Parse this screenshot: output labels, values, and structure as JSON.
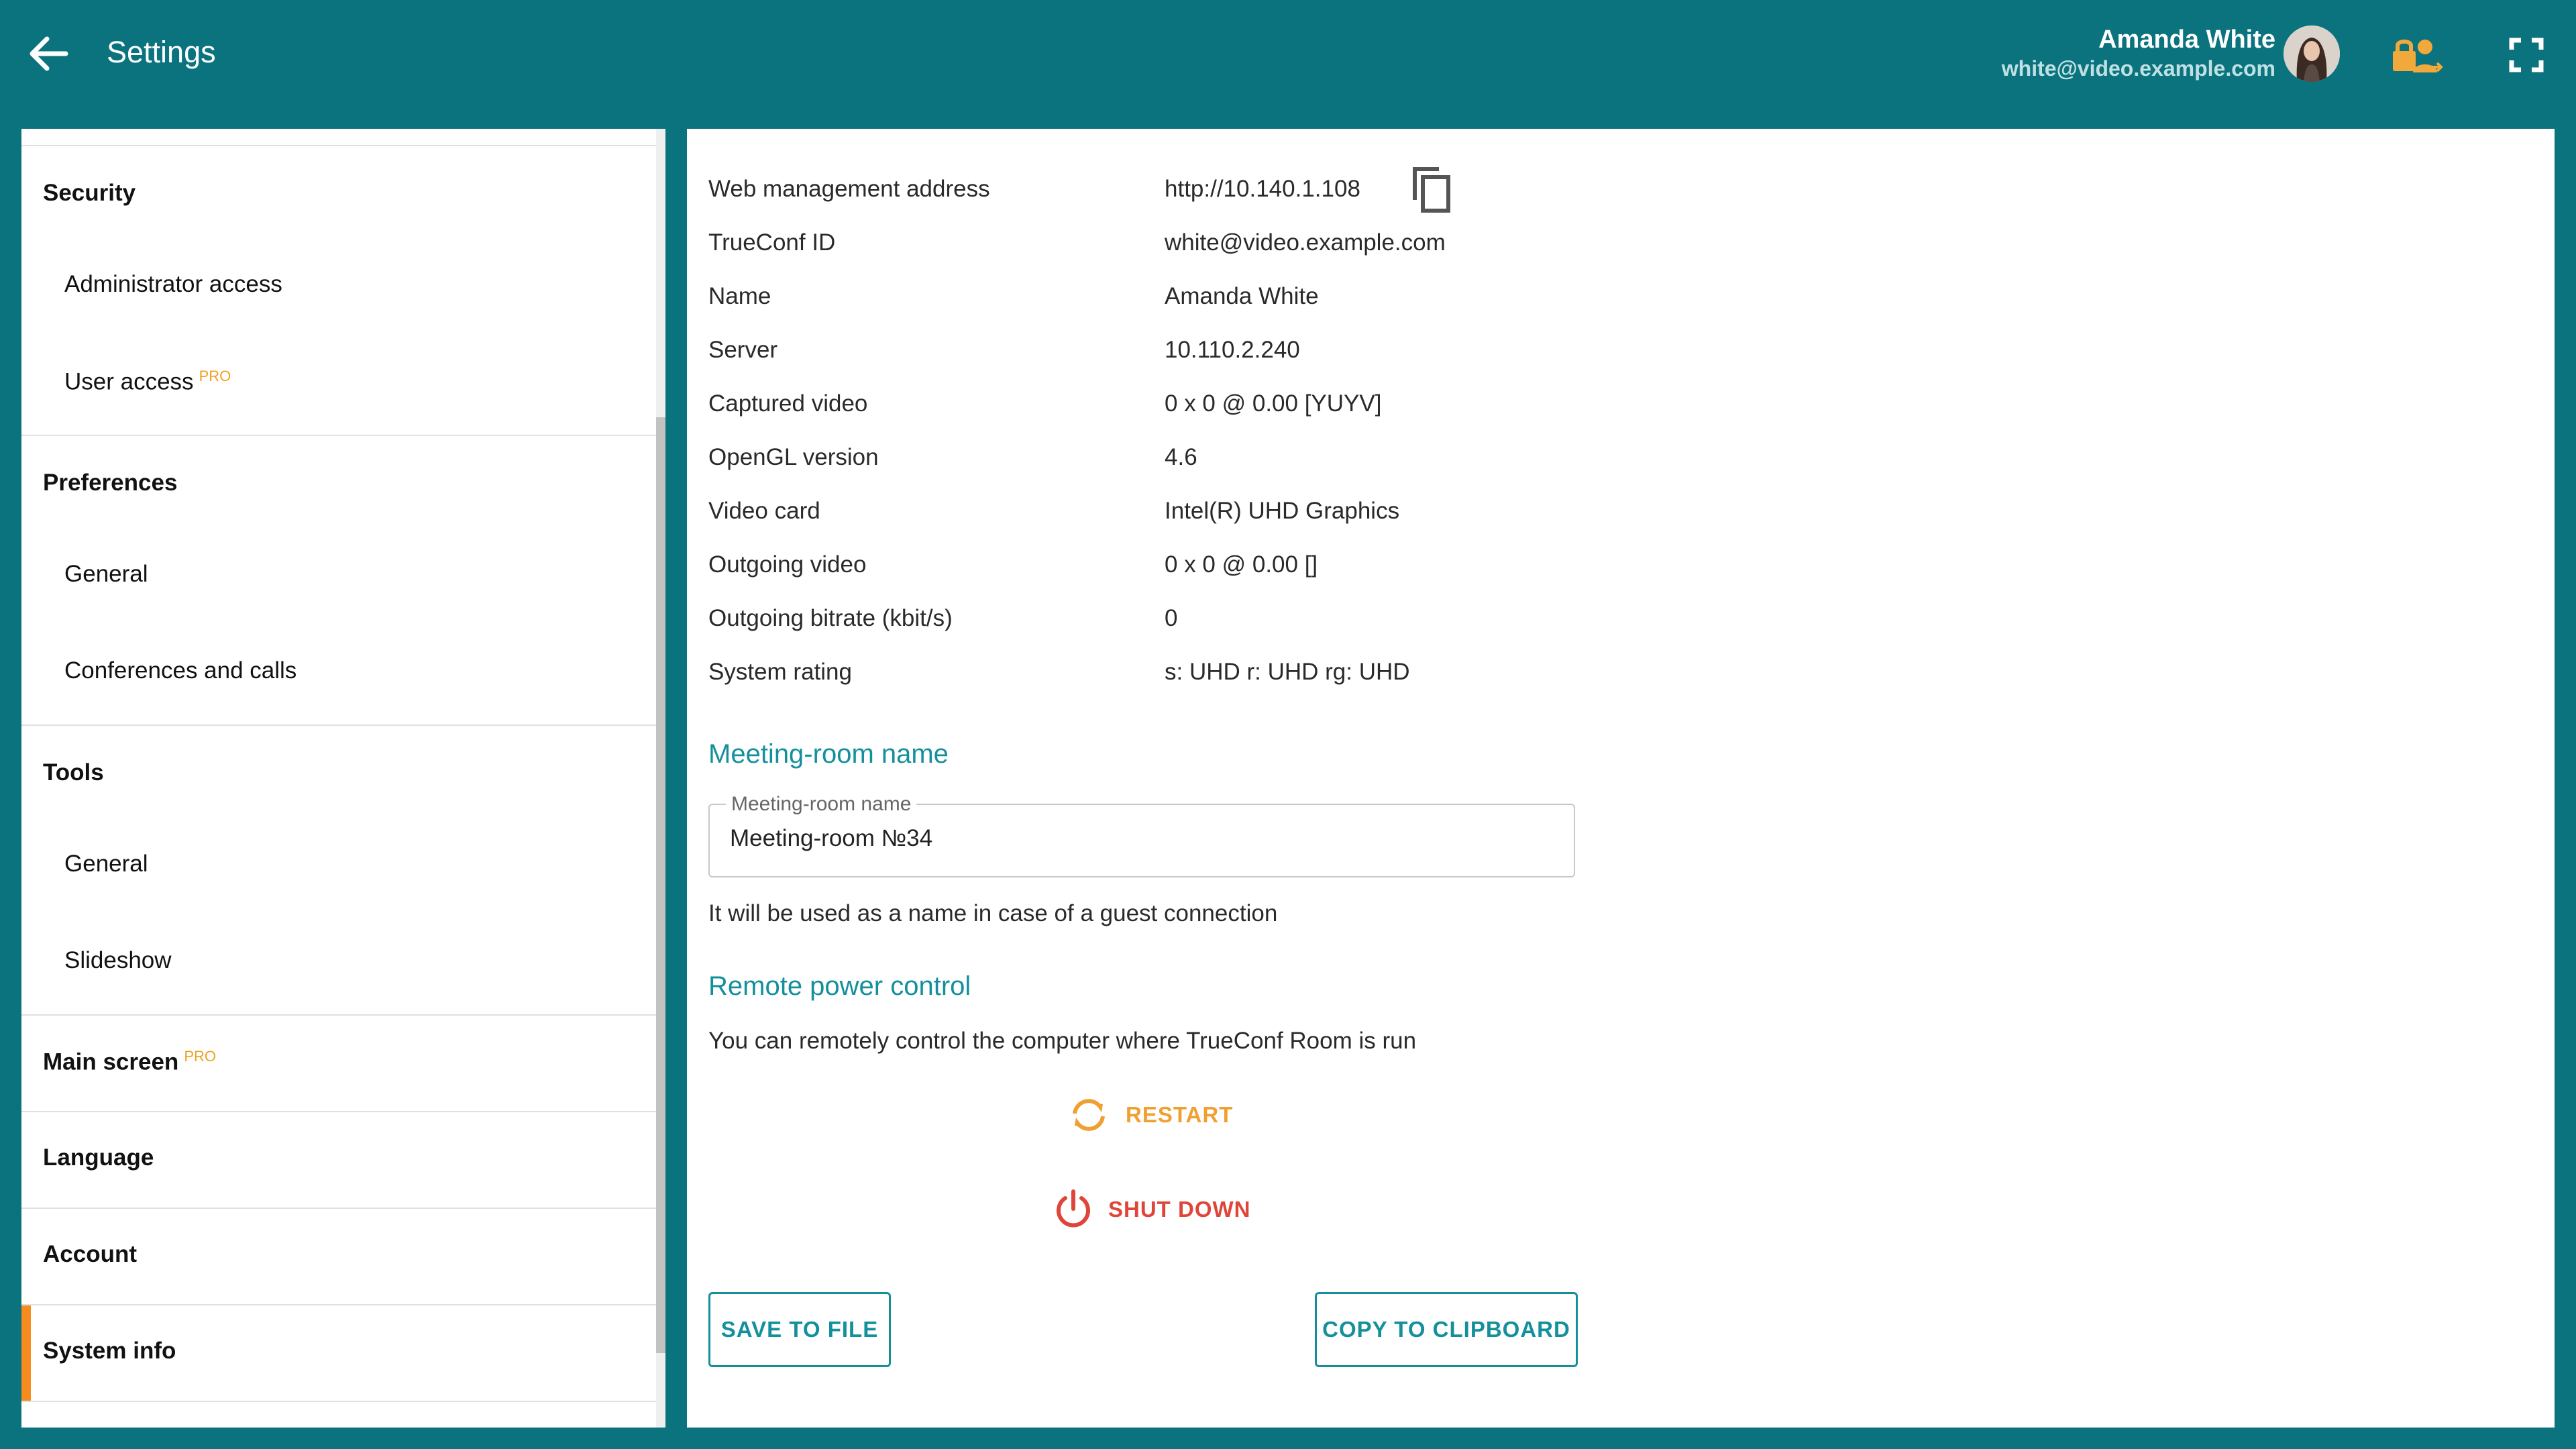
{
  "header": {
    "title": "Settings",
    "user_name": "Amanda White",
    "user_email": "white@video.example.com"
  },
  "sidebar": {
    "sections": [
      {
        "heading": "Security",
        "items": [
          {
            "label": "Administrator access",
            "pro": ""
          },
          {
            "label": "User access",
            "pro": "PRO"
          }
        ]
      },
      {
        "heading": "Preferences",
        "items": [
          {
            "label": "General",
            "pro": ""
          },
          {
            "label": "Conferences and calls",
            "pro": ""
          }
        ]
      },
      {
        "heading": "Tools",
        "items": [
          {
            "label": "General",
            "pro": ""
          },
          {
            "label": "Slideshow",
            "pro": ""
          }
        ]
      },
      {
        "heading": "Main screen",
        "pro": "PRO"
      },
      {
        "heading": "Language"
      },
      {
        "heading": "Account"
      },
      {
        "heading": "System info",
        "active": true
      }
    ]
  },
  "info": {
    "rows": [
      {
        "label": "Web management address",
        "value": "http://10.140.1.108"
      },
      {
        "label": "TrueConf ID",
        "value": "white@video.example.com"
      },
      {
        "label": "Name",
        "value": "Amanda White"
      },
      {
        "label": "Server",
        "value": "10.110.2.240"
      },
      {
        "label": "Captured video",
        "value": "0 x 0 @ 0.00 [YUYV]"
      },
      {
        "label": "OpenGL version",
        "value": "4.6"
      },
      {
        "label": "Video card",
        "value": "Intel(R) UHD Graphics"
      },
      {
        "label": "Outgoing video",
        "value": "0 x 0 @ 0.00 []"
      },
      {
        "label": "Outgoing bitrate (kbit/s)",
        "value": "0"
      },
      {
        "label": "System rating",
        "value": "s: UHD r: UHD rg: UHD"
      }
    ]
  },
  "meeting_room": {
    "section_title": "Meeting-room name",
    "field_label": "Meeting-room name",
    "value": "Meeting-room №34",
    "helper": "It will be used as a name in case of a guest connection"
  },
  "power": {
    "section_title": "Remote power control",
    "description": "You can remotely control the computer where TrueConf Room is run",
    "restart_label": "RESTART",
    "shutdown_label": "SHUT DOWN"
  },
  "actions": {
    "save_label": "SAVE TO FILE",
    "copy_label": "COPY TO CLIPBOARD"
  },
  "icons": {
    "back": "arrow-left-icon",
    "lock": "lock-user-icon",
    "fullscreen": "fullscreen-icon",
    "copy": "copy-icon",
    "restart": "restart-icon",
    "power": "power-icon"
  },
  "colors": {
    "header_bg": "#0b737e",
    "accent": "#14909c",
    "orange": "#f0a030",
    "red": "#e0453a",
    "active_indicator": "#f68b1f"
  }
}
